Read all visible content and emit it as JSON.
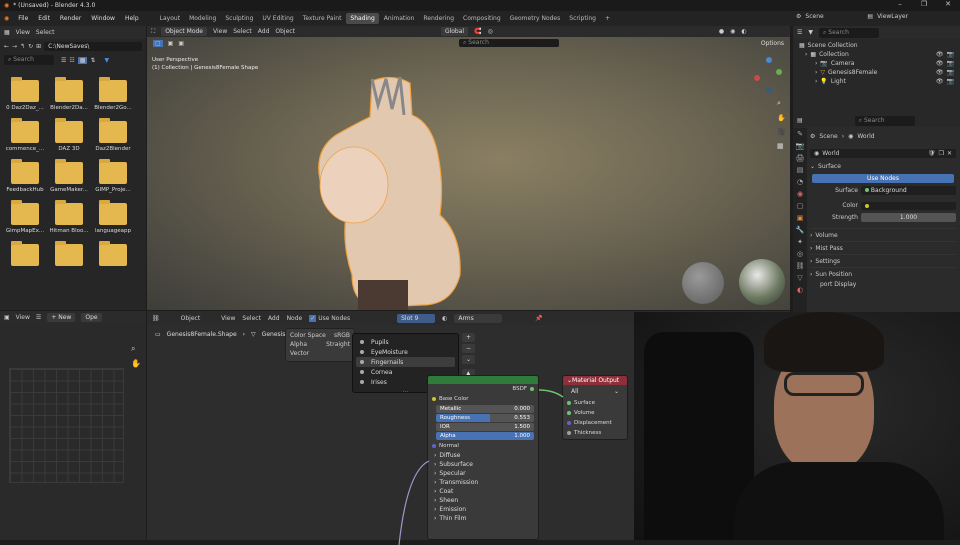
{
  "window": {
    "title": "* (Unsaved) - Blender 4.3.0",
    "min": "–",
    "max": "❐",
    "close": "✕"
  },
  "menu": [
    "File",
    "Edit",
    "Render",
    "Window",
    "Help"
  ],
  "workspaces": [
    "Layout",
    "Modeling",
    "Sculpting",
    "UV Editing",
    "Texture Paint",
    "Shading",
    "Animation",
    "Rendering",
    "Compositing",
    "Geometry Nodes",
    "Scripting"
  ],
  "active_workspace": "Shading",
  "add_tab": "+",
  "scene": {
    "label": "Scene",
    "view_layer": "ViewLayer"
  },
  "file_browser": {
    "menus": [
      "View",
      "Select"
    ],
    "path": "C:\\NewSaves\\",
    "search_placeholder": "Search",
    "folders": [
      "0 Daz2Daz_...",
      "Blender2Da...",
      "Blender2Go...",
      "commence_...",
      "DAZ 3D",
      "Daz2Blender",
      "FeedbackHub",
      "GameMaker...",
      "GIMP_Proje...",
      "GimpMapEx...",
      "Hitman Bloo...",
      "languageapp",
      "",
      "",
      ""
    ]
  },
  "viewport_header": {
    "mode": "Object Mode",
    "menus": [
      "View",
      "Select",
      "Add",
      "Object"
    ],
    "orientation": "Global",
    "search_placeholder": "Search",
    "options": "Options"
  },
  "viewport": {
    "perspective": "User Perspective",
    "collection": "(1) Collection | Genesis8Female Shape"
  },
  "image_editor_header": {
    "view": "View",
    "new": "New",
    "open": "Ope"
  },
  "node_header": {
    "type": "Object",
    "menus": [
      "View",
      "Select",
      "Add",
      "Node"
    ],
    "use_nodes": "Use Nodes",
    "slot": "Slot 9",
    "material": "Arms"
  },
  "breadcrumb": {
    "obj": "Genesis8Female.Shape",
    "mesh": "Genesis8Fem"
  },
  "mapping_node": {
    "labels": [
      "Color Space",
      "Alpha",
      "Vector"
    ],
    "right": [
      "sRGB",
      "Straight"
    ],
    "abbrev": "s RG"
  },
  "slot_list": {
    "items": [
      "Pupils",
      "EyeMoisture",
      "Fingernails",
      "Cornea",
      "Irises"
    ],
    "selected": "Fingernails",
    "more": "..."
  },
  "bsdf": {
    "output": "BSDF",
    "base_color": "Base Color",
    "fields": [
      {
        "label": "Metallic",
        "value": "0.000",
        "fill": 0.0
      },
      {
        "label": "Roughness",
        "value": "0.553",
        "fill": 0.553
      },
      {
        "label": "IOR",
        "value": "1.500",
        "fill": 0.0
      },
      {
        "label": "Alpha",
        "value": "1.000",
        "fill": 1.0
      }
    ],
    "normal": "Normal",
    "panels": [
      "Diffuse",
      "Subsurface",
      "Specular",
      "Transmission",
      "Coat",
      "Sheen",
      "Emission",
      "Thin Film"
    ]
  },
  "material_output": {
    "title": "Material Output",
    "target": "All",
    "sockets": [
      "Surface",
      "Volume",
      "Displacement",
      "Thickness"
    ]
  },
  "outliner": {
    "search_placeholder": "Search",
    "root": "Scene Collection",
    "items": [
      {
        "name": "Collection",
        "indent": 0
      },
      {
        "name": "Camera",
        "indent": 1
      },
      {
        "name": "Genesis8Female",
        "indent": 1
      },
      {
        "name": "Light",
        "indent": 1
      }
    ]
  },
  "properties": {
    "search_placeholder": "Search",
    "breadcrumb": [
      "Scene",
      "World"
    ],
    "world_name": "World",
    "surface_label": "Surface",
    "use_nodes": "Use Nodes",
    "surface_field_label": "Surface",
    "surface_value": "Background",
    "color_label": "Color",
    "strength_label": "Strength",
    "strength_value": "1.000",
    "panels": [
      "Volume",
      "Mist Pass",
      "Settings",
      "Sun Position"
    ],
    "viewport_display": "port Display"
  },
  "colors": {
    "accent": "#4772b3",
    "orange_select": "#f0a040",
    "folder": "#e5b74f",
    "node_header_green": "#2f7b3a",
    "node_header_red": "#8e2f3a"
  }
}
